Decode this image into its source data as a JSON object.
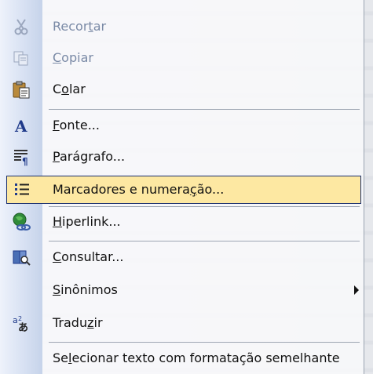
{
  "menu": {
    "items": [
      {
        "label": "Recortar",
        "mnemonic_index": 5,
        "icon": "scissors-icon",
        "disabled": true
      },
      {
        "label": "Copiar",
        "mnemonic_index": 0,
        "icon": "copy-icon",
        "disabled": true
      },
      {
        "label": "Colar",
        "mnemonic_index": 1,
        "icon": "paste-icon",
        "disabled": false
      },
      {
        "label": "Fonte...",
        "mnemonic_index": 0,
        "icon": "font-icon",
        "disabled": false
      },
      {
        "label": "Parágrafo...",
        "mnemonic_index": 0,
        "icon": "paragraph-icon",
        "disabled": false
      },
      {
        "label": "Marcadores e numeração...",
        "mnemonic_index": 19,
        "icon": "bullets-icon",
        "disabled": false,
        "highlighted": true
      },
      {
        "label": "Hiperlink...",
        "mnemonic_index": 0,
        "icon": "hyperlink-icon",
        "disabled": false
      },
      {
        "label": "Consultar...",
        "mnemonic_index": 0,
        "icon": "research-icon",
        "disabled": false
      },
      {
        "label": "Sinônimos",
        "mnemonic_index": 0,
        "icon": "",
        "disabled": false,
        "submenu": true
      },
      {
        "label": "Traduzir",
        "mnemonic_index": 5,
        "icon": "translate-icon",
        "disabled": false
      },
      {
        "label": "Selecionar texto com formatação semelhante",
        "mnemonic_index": 2,
        "icon": "",
        "disabled": false
      }
    ]
  },
  "colors": {
    "highlight_fill": "#fde8a2",
    "highlight_border": "#1b2f6d",
    "disabled_text": "#7a8aa6",
    "gutter": "#d6e0f2"
  }
}
